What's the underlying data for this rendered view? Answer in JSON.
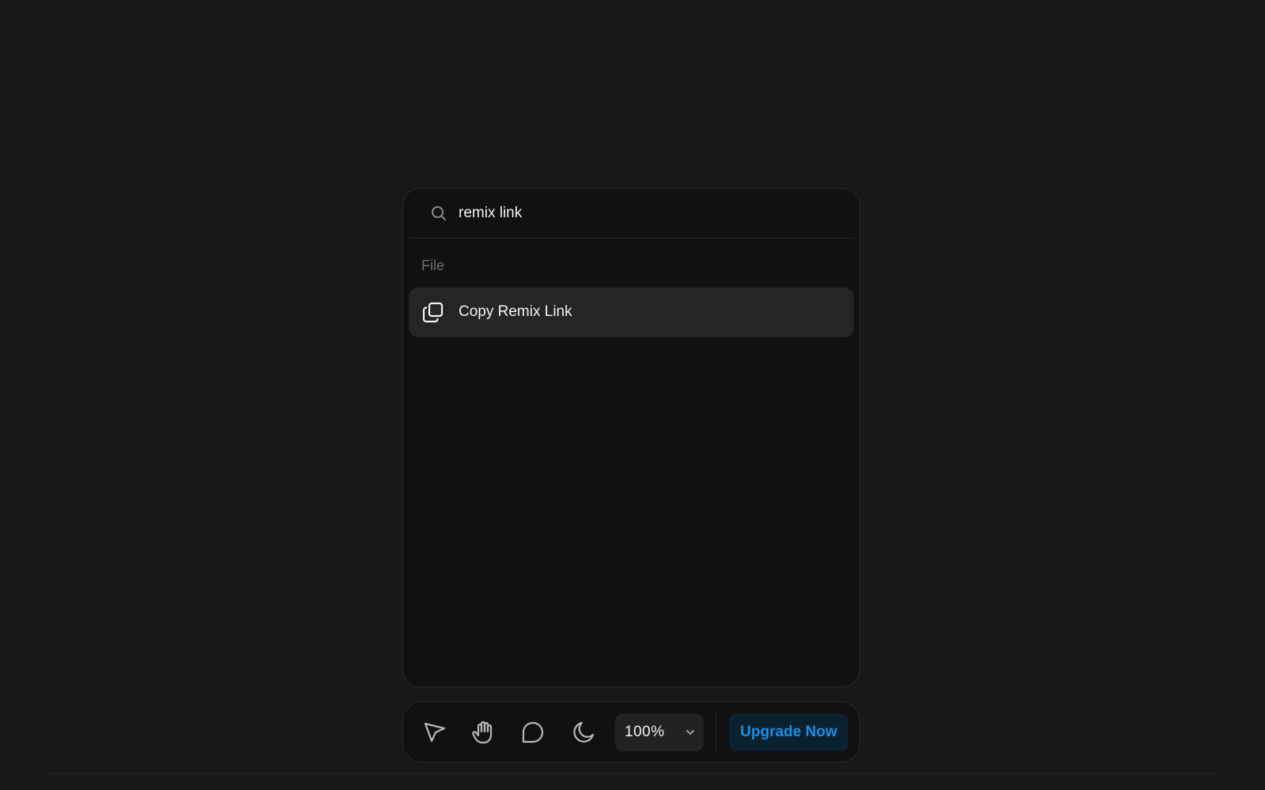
{
  "search": {
    "value": "remix link",
    "icon": "search-icon"
  },
  "results": {
    "group_label": "File",
    "items": [
      {
        "label": "Copy Remix Link",
        "icon": "copy-icon"
      }
    ]
  },
  "toolbar": {
    "tools": [
      {
        "name": "select-tool",
        "icon": "cursor-icon"
      },
      {
        "name": "hand-tool",
        "icon": "hand-icon"
      },
      {
        "name": "comment-tool",
        "icon": "comment-icon"
      },
      {
        "name": "theme-toggle",
        "icon": "moon-icon"
      }
    ],
    "zoom_value": "100%",
    "upgrade_label": "Upgrade Now"
  },
  "colors": {
    "background": "#181818",
    "panel": "#111111",
    "selected_item": "#252525",
    "accent": "#1a8fe6",
    "accent_bg": "#0c2130"
  }
}
